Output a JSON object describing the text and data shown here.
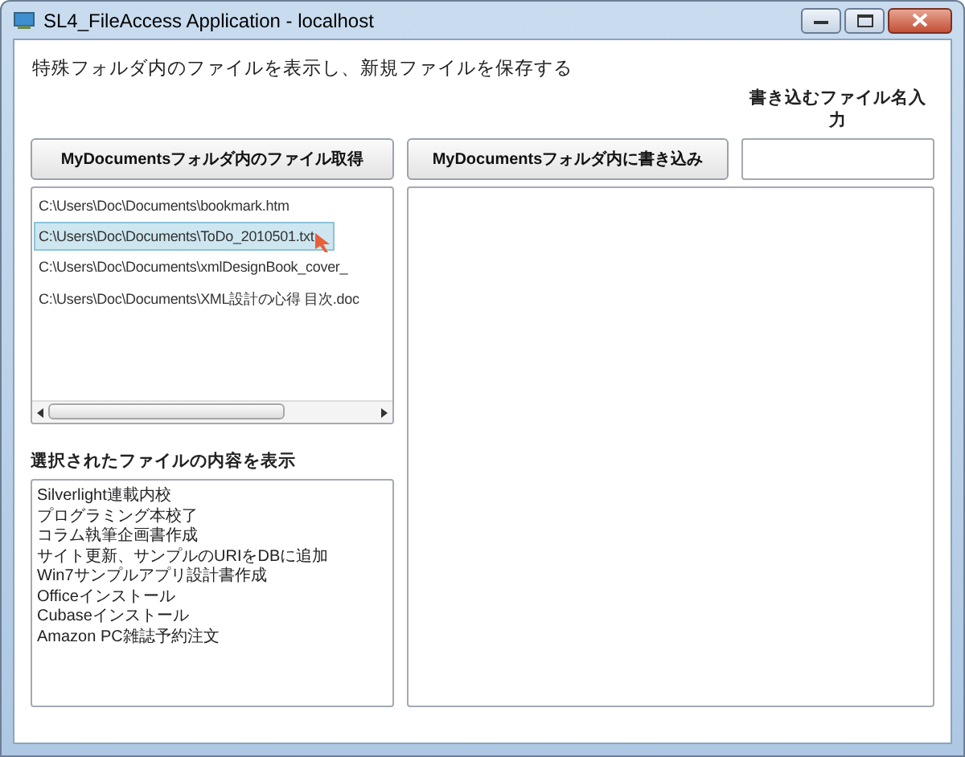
{
  "window": {
    "title": "SL4_FileAccess Application - localhost"
  },
  "heading": "特殊フォルダ内のファイルを表示し、新規ファイルを保存する",
  "filename_label": "書き込むファイル名入力",
  "get_button": "MyDocumentsフォルダ内のファイル取得",
  "write_button": "MyDocumentsフォルダ内に書き込み",
  "files": [
    {
      "path": "C:\\Users\\Doc\\Documents\\bookmark.htm",
      "selected": false
    },
    {
      "path": "C:\\Users\\Doc\\Documents\\ToDo_2010501.txt",
      "selected": true
    },
    {
      "path": "C:\\Users\\Doc\\Documents\\xmlDesignBook_cover_",
      "selected": false
    },
    {
      "path": "C:\\Users\\Doc\\Documents\\XML設計の心得 目次.doc",
      "selected": false
    }
  ],
  "content_label": "選択されたファイルの内容を表示",
  "content_lines": [
    "Silverlight連載内校",
    "プログラミング本校了",
    "コラム執筆企画書作成",
    "サイト更新、サンプルのURIをDBに追加",
    "Win7サンプルアプリ設計書作成",
    "Officeインストール",
    "Cubaseインストール",
    "Amazon PC雑誌予約注文"
  ]
}
